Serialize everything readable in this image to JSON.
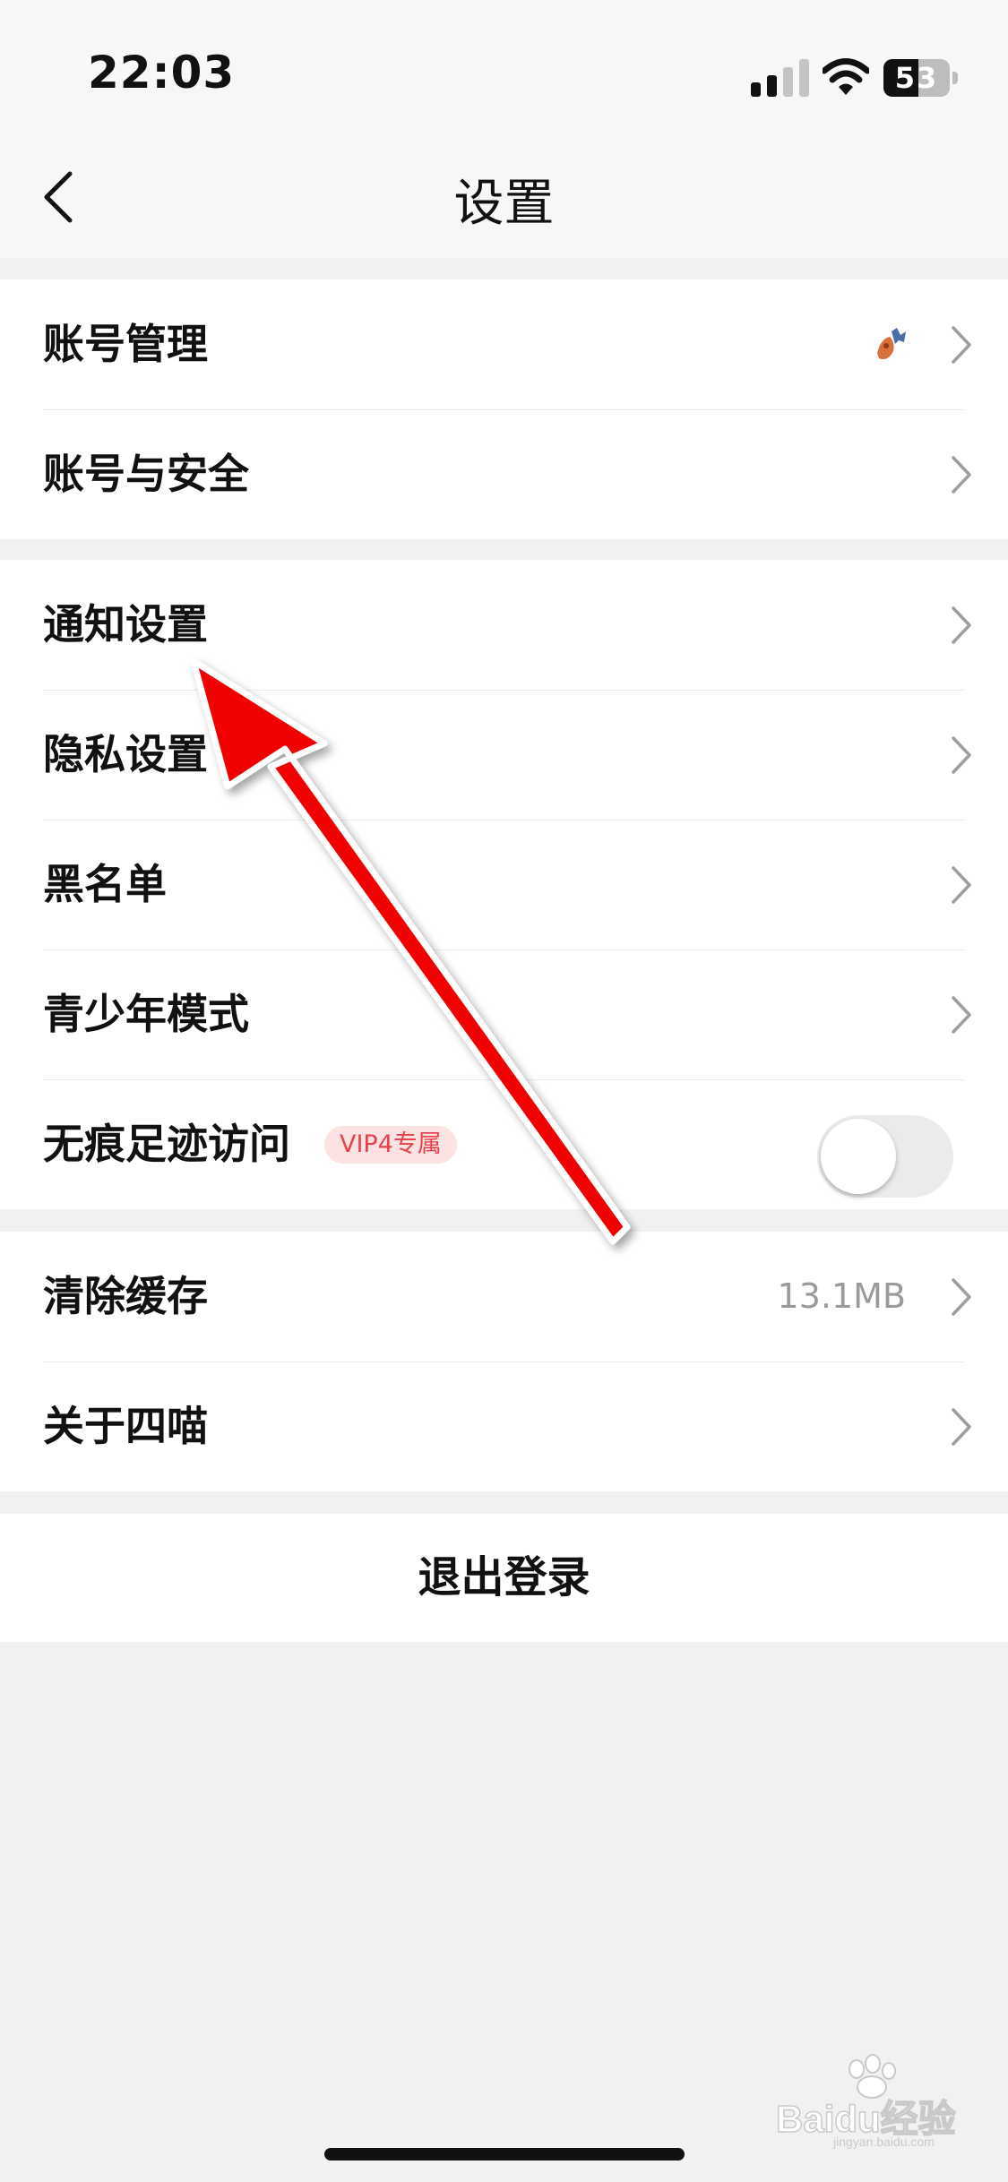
{
  "status_bar": {
    "time": "22:03",
    "battery": {
      "text": "53",
      "level_percent": 53
    }
  },
  "header": {
    "title": "设置"
  },
  "groups": [
    {
      "items": [
        {
          "label": "账号管理",
          "trailing": "avatar"
        },
        {
          "label": "账号与安全"
        }
      ]
    },
    {
      "items": [
        {
          "label": "通知设置"
        },
        {
          "label": "隐私设置"
        },
        {
          "label": "黑名单"
        },
        {
          "label": "青少年模式"
        },
        {
          "label": "无痕足迹访问",
          "badge": "VIP4专属",
          "toggle_on": false
        }
      ]
    },
    {
      "items": [
        {
          "label": "清除缓存",
          "value": "13.1MB"
        },
        {
          "label": "关于四喵"
        }
      ]
    }
  ],
  "logout": {
    "label": "退出登录"
  },
  "watermark": {
    "text": "Baidu经验",
    "subtext": "jingyan.baidu.com"
  },
  "colors": {
    "annotation_arrow": "#f00000",
    "badge_text": "#e4434b",
    "badge_bg": "#fde2e2",
    "page_bg": "#f1f1f1"
  },
  "icons": [
    "back-chevron-icon",
    "chevron-right-icon",
    "signal-icon",
    "wifi-icon",
    "battery-icon"
  ]
}
